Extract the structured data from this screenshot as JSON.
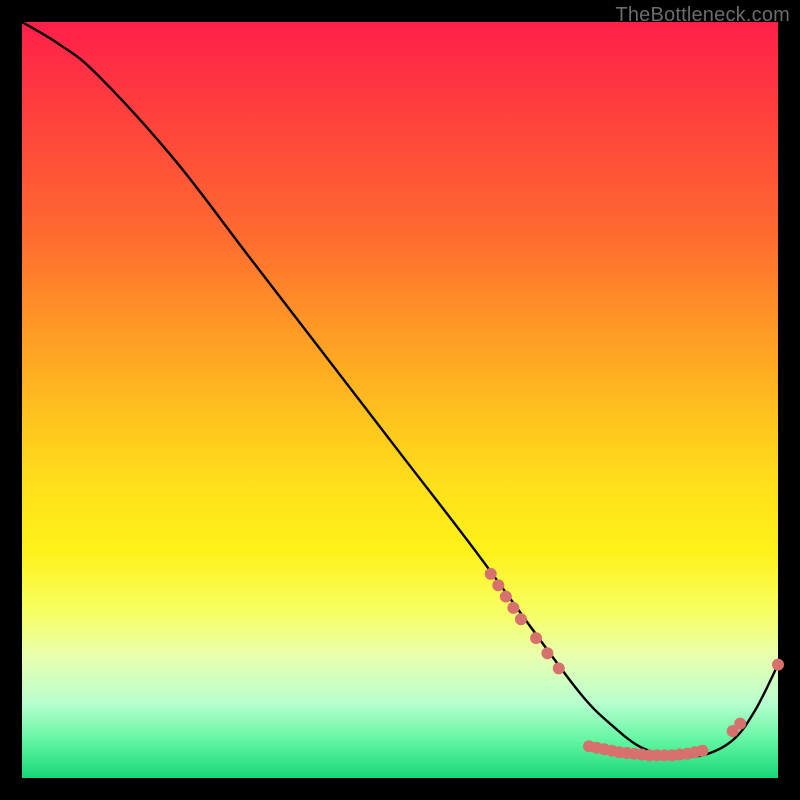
{
  "watermark": "TheBottleneck.com",
  "chart_data": {
    "type": "line",
    "title": "",
    "xlabel": "",
    "ylabel": "",
    "xlim": [
      0,
      100
    ],
    "ylim": [
      0,
      100
    ],
    "grid": false,
    "legend": false,
    "series": [
      {
        "name": "bottleneck-curve",
        "color": "#000000",
        "x": [
          0,
          5,
          10,
          20,
          30,
          40,
          50,
          60,
          68,
          74,
          78,
          82,
          86,
          90,
          94,
          97,
          100
        ],
        "y": [
          100,
          97,
          93,
          82,
          69,
          56,
          43,
          30,
          19,
          11,
          7,
          4,
          3,
          3,
          5,
          9,
          15
        ]
      }
    ],
    "markers": [
      {
        "name": "cluster-points",
        "color": "#d6716d",
        "radius_px": 6,
        "points": [
          {
            "x": 62,
            "y": 27
          },
          {
            "x": 63,
            "y": 25.5
          },
          {
            "x": 64,
            "y": 24
          },
          {
            "x": 65,
            "y": 22.5
          },
          {
            "x": 66,
            "y": 21
          },
          {
            "x": 68,
            "y": 18.5
          },
          {
            "x": 69.5,
            "y": 16.5
          },
          {
            "x": 71,
            "y": 14.5
          },
          {
            "x": 75,
            "y": 4.2
          },
          {
            "x": 76,
            "y": 4.0
          },
          {
            "x": 77,
            "y": 3.8
          },
          {
            "x": 78,
            "y": 3.6
          },
          {
            "x": 79,
            "y": 3.4
          },
          {
            "x": 80,
            "y": 3.3
          },
          {
            "x": 81,
            "y": 3.2
          },
          {
            "x": 82,
            "y": 3.1
          },
          {
            "x": 83,
            "y": 3.0
          },
          {
            "x": 84,
            "y": 3.0
          },
          {
            "x": 85,
            "y": 3.0
          },
          {
            "x": 86,
            "y": 3.0
          },
          {
            "x": 87,
            "y": 3.1
          },
          {
            "x": 88,
            "y": 3.2
          },
          {
            "x": 89,
            "y": 3.4
          },
          {
            "x": 90,
            "y": 3.6
          },
          {
            "x": 94,
            "y": 6.2
          },
          {
            "x": 95,
            "y": 7.2
          },
          {
            "x": 100,
            "y": 15
          }
        ]
      }
    ]
  }
}
